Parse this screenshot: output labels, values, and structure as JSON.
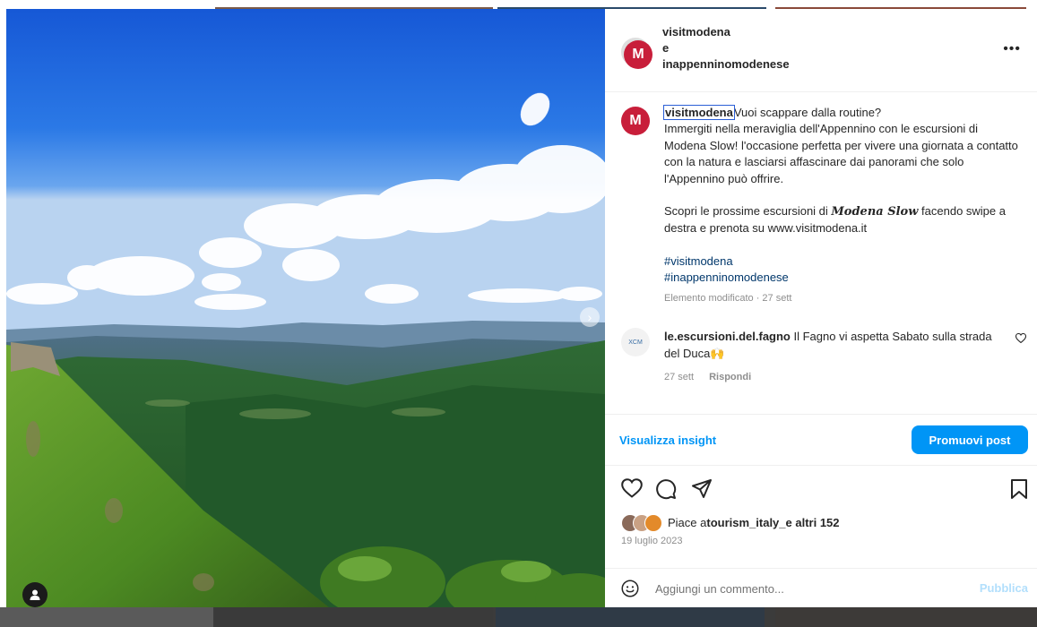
{
  "post": {
    "header": {
      "username": "visitmodena",
      "conjunction": "e",
      "collaborator": "inappenninomodenese",
      "avatar_letter": "M",
      "more_icon": "more-horizontal-icon"
    },
    "caption": {
      "username": "visitmodena",
      "line1": "Vuoi scappare dalla routine?",
      "line2": "Immergiti nella meraviglia dell'Appennino con le escursioni di Modena Slow! l'occasione perfetta per vivere una giornata a contatto con la natura e lasciarsi affascinare dai panorami che solo l'Appennino può offrire.",
      "line3_before": "Scopri le prossime escursioni di ",
      "line3_brand": "Modena Slow",
      "line3_after": " facendo swipe a destra e prenota su www.visitmodena.it",
      "hashtag1": "#visitmodena",
      "hashtag2": "#inappenninomodenese",
      "meta": "Elemento modificato · 27 sett"
    },
    "comment": {
      "avatar_text": "XCM",
      "username": "le.escursioni.del.fagno",
      "text": " Il Fagno vi aspetta Sabato sulla strada del Duca🙌",
      "time": "27 sett",
      "reply": "Rispondi"
    },
    "insights": {
      "link": "Visualizza insight",
      "promote": "Promuovi post"
    },
    "likes": {
      "prefix": "Piace a ",
      "user": "tourism_italy_",
      "suffix": " e altri 152"
    },
    "date": "19 luglio 2023",
    "add_comment": {
      "placeholder": "Aggiungi un commento...",
      "publish": "Pubblica"
    }
  },
  "colors": {
    "accent": "#0095f6",
    "brand": "#c81e3a",
    "hashtag": "#00376b",
    "muted": "#8e8e8e"
  },
  "icons": {
    "like": "heart-icon",
    "comment": "comment-icon",
    "share": "send-icon",
    "save": "bookmark-icon",
    "emoji": "emoji-icon",
    "next": "chevron-right-icon",
    "tag": "user-tag-icon"
  }
}
